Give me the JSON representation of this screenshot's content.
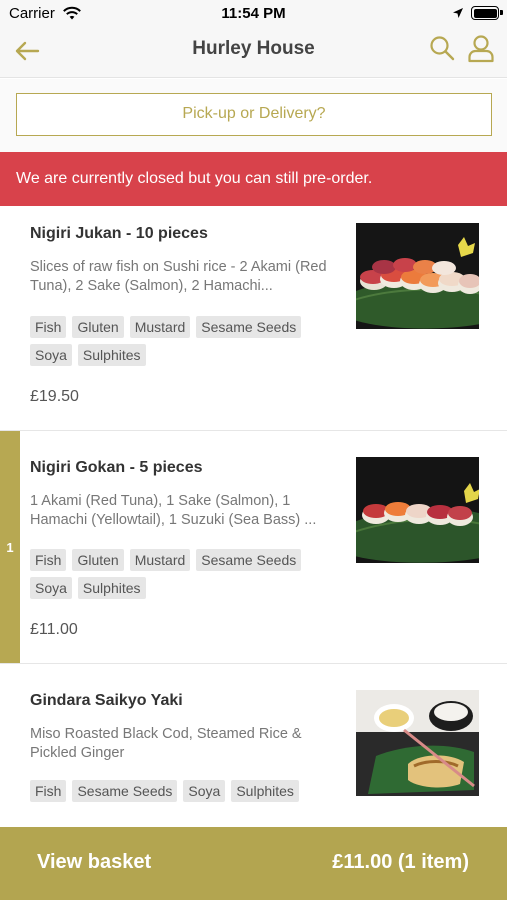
{
  "status_bar": {
    "carrier": "Carrier",
    "time": "11:54 PM",
    "wifi_icon": "wifi-icon",
    "location_icon": "location-arrow-icon",
    "battery_icon": "battery-icon",
    "battery_level": 1.0
  },
  "nav": {
    "title": "Hurley House",
    "back_icon": "arrow-left-icon",
    "search_icon": "search-icon",
    "account_icon": "user-icon"
  },
  "order_mode": {
    "label": "Pick-up or Delivery?"
  },
  "banner": {
    "text": "We are currently closed but you can still pre-order."
  },
  "menu_items": [
    {
      "name": "Nigiri Jukan - 10 pieces",
      "description": "Slices of raw fish on Sushi rice - 2 Akami (Red Tuna), 2 Sake (Salmon), 2 Hamachi...",
      "tags": [
        "Fish",
        "Gluten",
        "Mustard",
        "Sesame Seeds",
        "Soya",
        "Sulphites"
      ],
      "price": "£19.50",
      "quantity": ""
    },
    {
      "name": "Nigiri Gokan - 5 pieces",
      "description": "1 Akami (Red Tuna), 1 Sake (Salmon), 1 Hamachi (Yellowtail), 1 Suzuki (Sea Bass) ...",
      "tags": [
        "Fish",
        "Gluten",
        "Mustard",
        "Sesame Seeds",
        "Soya",
        "Sulphites"
      ],
      "price": "£11.00",
      "quantity": "1"
    },
    {
      "name": "Gindara Saikyo Yaki",
      "description": "Miso Roasted Black Cod, Steamed Rice & Pickled Ginger",
      "tags": [
        "Fish",
        "Sesame Seeds",
        "Soya",
        "Sulphites"
      ],
      "price": "",
      "quantity": ""
    }
  ],
  "basket": {
    "label": "View basket",
    "total": "£11.00 (1 item)"
  },
  "colors": {
    "accent": "#b7a852",
    "banner": "#d8424b",
    "tag_bg": "#e6e6e6"
  }
}
